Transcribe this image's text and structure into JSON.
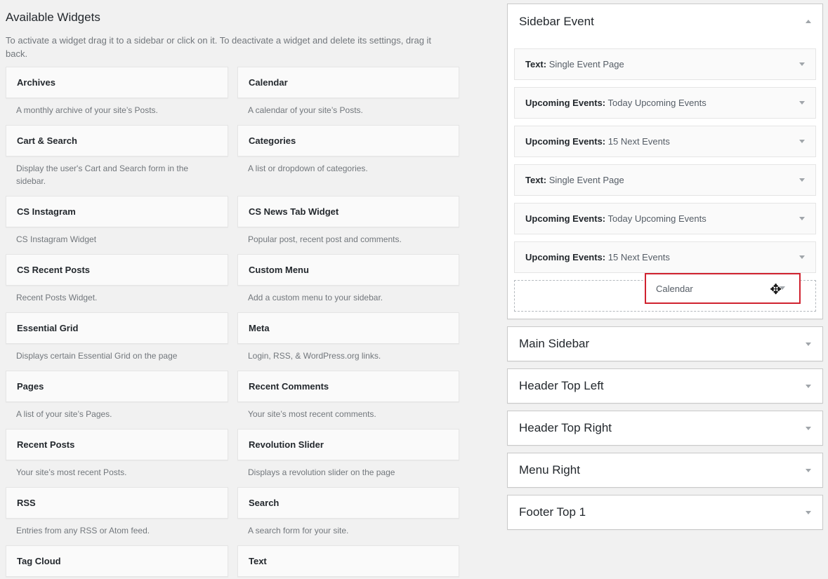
{
  "available": {
    "title": "Available Widgets",
    "intro": "To activate a widget drag it to a sidebar or click on it. To deactivate a widget and delete its settings, drag it back.",
    "widgets": [
      {
        "name": "Archives",
        "desc": "A monthly archive of your site’s Posts."
      },
      {
        "name": "Calendar",
        "desc": "A calendar of your site’s Posts."
      },
      {
        "name": "Cart & Search",
        "desc": "Display the user's Cart and Search form in the sidebar."
      },
      {
        "name": "Categories",
        "desc": "A list or dropdown of categories."
      },
      {
        "name": "CS Instagram",
        "desc": "CS Instagram Widget"
      },
      {
        "name": "CS News Tab Widget",
        "desc": "Popular post, recent post and comments."
      },
      {
        "name": "CS Recent Posts",
        "desc": "Recent Posts Widget."
      },
      {
        "name": "Custom Menu",
        "desc": "Add a custom menu to your sidebar."
      },
      {
        "name": "Essential Grid",
        "desc": "Displays certain Essential Grid on the page"
      },
      {
        "name": "Meta",
        "desc": "Login, RSS, & WordPress.org links."
      },
      {
        "name": "Pages",
        "desc": "A list of your site’s Pages."
      },
      {
        "name": "Recent Comments",
        "desc": "Your site’s most recent comments."
      },
      {
        "name": "Recent Posts",
        "desc": "Your site’s most recent Posts."
      },
      {
        "name": "Revolution Slider",
        "desc": "Displays a revolution slider on the page"
      },
      {
        "name": "RSS",
        "desc": "Entries from any RSS or Atom feed."
      },
      {
        "name": "Search",
        "desc": "A search form for your site."
      },
      {
        "name": "Tag Cloud",
        "desc": ""
      },
      {
        "name": "Text",
        "desc": ""
      }
    ]
  },
  "sidebars": {
    "event": {
      "title": "Sidebar Event",
      "widgets": [
        {
          "type": "Text:",
          "instance": "Single Event Page"
        },
        {
          "type": "Upcoming Events:",
          "instance": "Today Upcoming Events"
        },
        {
          "type": "Upcoming Events:",
          "instance": "15 Next Events"
        },
        {
          "type": "Text:",
          "instance": "Single Event Page"
        },
        {
          "type": "Upcoming Events:",
          "instance": "Today Upcoming Events"
        },
        {
          "type": "Upcoming Events:",
          "instance": "15 Next Events"
        }
      ],
      "dragging_label": "Calendar"
    },
    "collapsed": [
      {
        "title": "Main Sidebar"
      },
      {
        "title": "Header Top Left"
      },
      {
        "title": "Header Top Right"
      },
      {
        "title": "Menu Right"
      },
      {
        "title": "Footer Top 1"
      }
    ]
  },
  "icons": {
    "collapse_arrow": "arrow-up-icon",
    "expand_arrow": "arrow-down-icon",
    "move_cursor": "move-cursor-icon",
    "cursor_glyph": "✥"
  },
  "colors": {
    "highlight_border": "#d0222f",
    "background": "#f1f1f1"
  }
}
